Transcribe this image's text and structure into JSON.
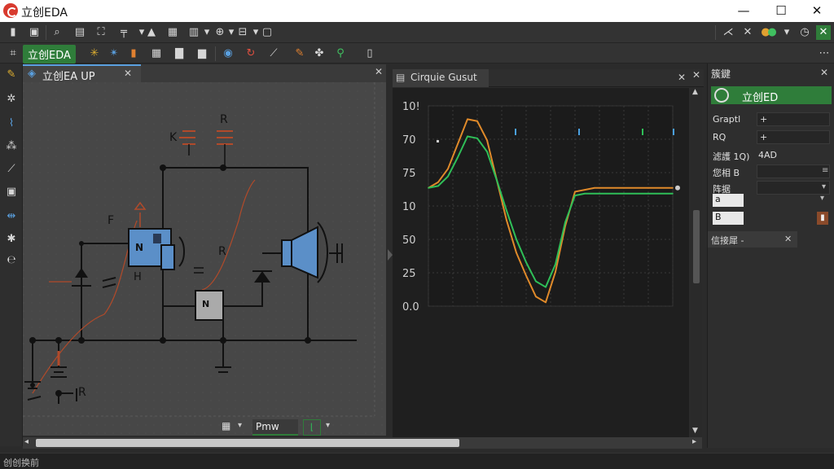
{
  "app": {
    "title": "立创EDA"
  },
  "window": {
    "minimize": "—",
    "maximize": "☐",
    "close": "✕"
  },
  "toolbar2": {
    "app_badge": "立创EDA"
  },
  "schematic": {
    "tab_title": "立创EA UP",
    "tab_close": "✕",
    "labels": {
      "k": "K",
      "r_top": "R",
      "f": "F",
      "n_relay": "N",
      "h": "H",
      "r_mid": "R",
      "n_ic": "N",
      "r_bottom": "R"
    },
    "footer": {
      "zoom_value": "Pmw"
    },
    "panel_close": "✕"
  },
  "waveform": {
    "tab_title": "Cirquie Gusut",
    "tab_close": "✕",
    "panel_close": "✕",
    "chart_data": {
      "type": "line",
      "title": "",
      "y_tick_labels": [
        "10!",
        "70",
        "75",
        "10",
        "50",
        "25",
        "0.0"
      ],
      "x": [
        0,
        4,
        8,
        12,
        16,
        20,
        24,
        28,
        32,
        36,
        40,
        44,
        48,
        52,
        56,
        60,
        64,
        68,
        72,
        76,
        80,
        84,
        88,
        92,
        96,
        100
      ],
      "series": [
        {
          "color": "#e08a2a",
          "values": [
            6.2,
            6.5,
            7.2,
            8.5,
            9.8,
            9.7,
            8.7,
            6.6,
            4.5,
            2.8,
            1.6,
            0.5,
            0.2,
            1.8,
            4.2,
            6.0,
            6.1,
            6.2,
            6.2,
            6.2,
            6.2,
            6.2,
            6.2,
            6.2,
            6.2,
            6.2
          ]
        },
        {
          "color": "#2fbf58",
          "values": [
            6.2,
            6.3,
            6.8,
            7.8,
            8.9,
            8.8,
            8.1,
            6.6,
            5.0,
            3.5,
            2.3,
            1.3,
            1.0,
            2.2,
            4.4,
            5.8,
            5.9,
            5.9,
            5.9,
            5.9,
            5.9,
            5.9,
            5.9,
            5.9,
            5.9,
            5.9
          ]
        }
      ],
      "ylim": [
        0,
        10.5
      ],
      "grid": true
    }
  },
  "properties": {
    "title": "簇鍵",
    "close": "✕",
    "badge": "立创ED",
    "rows": [
      {
        "label": "Graptl",
        "value": "+"
      },
      {
        "label": "RQ",
        "value": "+"
      },
      {
        "label": "滤護 1Q)",
        "value": "4AD"
      },
      {
        "label": "您相 B",
        "value": ""
      },
      {
        "label": "阵据",
        "value": ""
      }
    ],
    "input_a": "a",
    "input_b": "B",
    "footer_tab": "信接犀 -",
    "footer_close": "✕"
  },
  "statusbar": {
    "text": "创创换前"
  }
}
